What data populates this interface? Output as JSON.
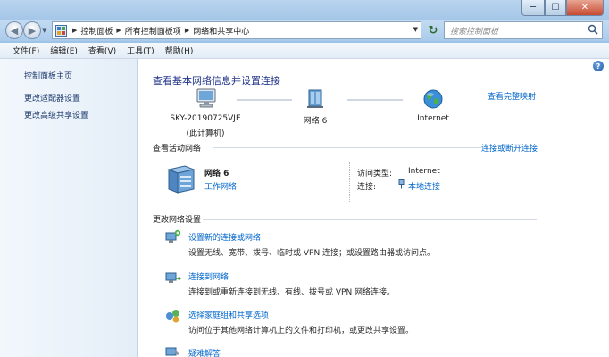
{
  "titlebar": {
    "min": "─",
    "max": "☐",
    "close": "✕"
  },
  "navbar": {
    "breadcrumbs": [
      "控制面板",
      "所有控制面板项",
      "网络和共享中心"
    ],
    "search_placeholder": "搜索控制面板"
  },
  "menubar": {
    "items": [
      "文件(F)",
      "编辑(E)",
      "查看(V)",
      "工具(T)",
      "帮助(H)"
    ]
  },
  "sidebar": {
    "items": [
      "控制面板主页",
      "更改适配器设置",
      "更改高级共享设置"
    ]
  },
  "main": {
    "heading": "查看基本网络信息并设置连接",
    "see_full_map": "查看完整映射",
    "map": {
      "computer_name": "SKY-20190725VJE",
      "computer_sub": "(此计算机)",
      "network_name": "网络  6",
      "internet": "Internet"
    },
    "active_title": "查看活动网络",
    "connect_disconnect": "连接或断开连接",
    "active": {
      "name": "网络  6",
      "type_link": "工作网络",
      "access_label": "访问类型:",
      "access_value": "Internet",
      "conn_label": "连接:",
      "conn_value": "本地连接"
    },
    "change_title": "更改网络设置",
    "tasks": [
      {
        "title": "设置新的连接或网络",
        "desc": "设置无线、宽带、拨号、临时或 VPN 连接；或设置路由器或访问点。"
      },
      {
        "title": "连接到网络",
        "desc": "连接到或重新连接到无线、有线、拨号或 VPN 网络连接。"
      },
      {
        "title": "选择家庭组和共享选项",
        "desc": "访问位于其他网络计算机上的文件和打印机，或更改共享设置。"
      },
      {
        "title": "疑难解答",
        "desc": ""
      }
    ]
  },
  "help": "?"
}
